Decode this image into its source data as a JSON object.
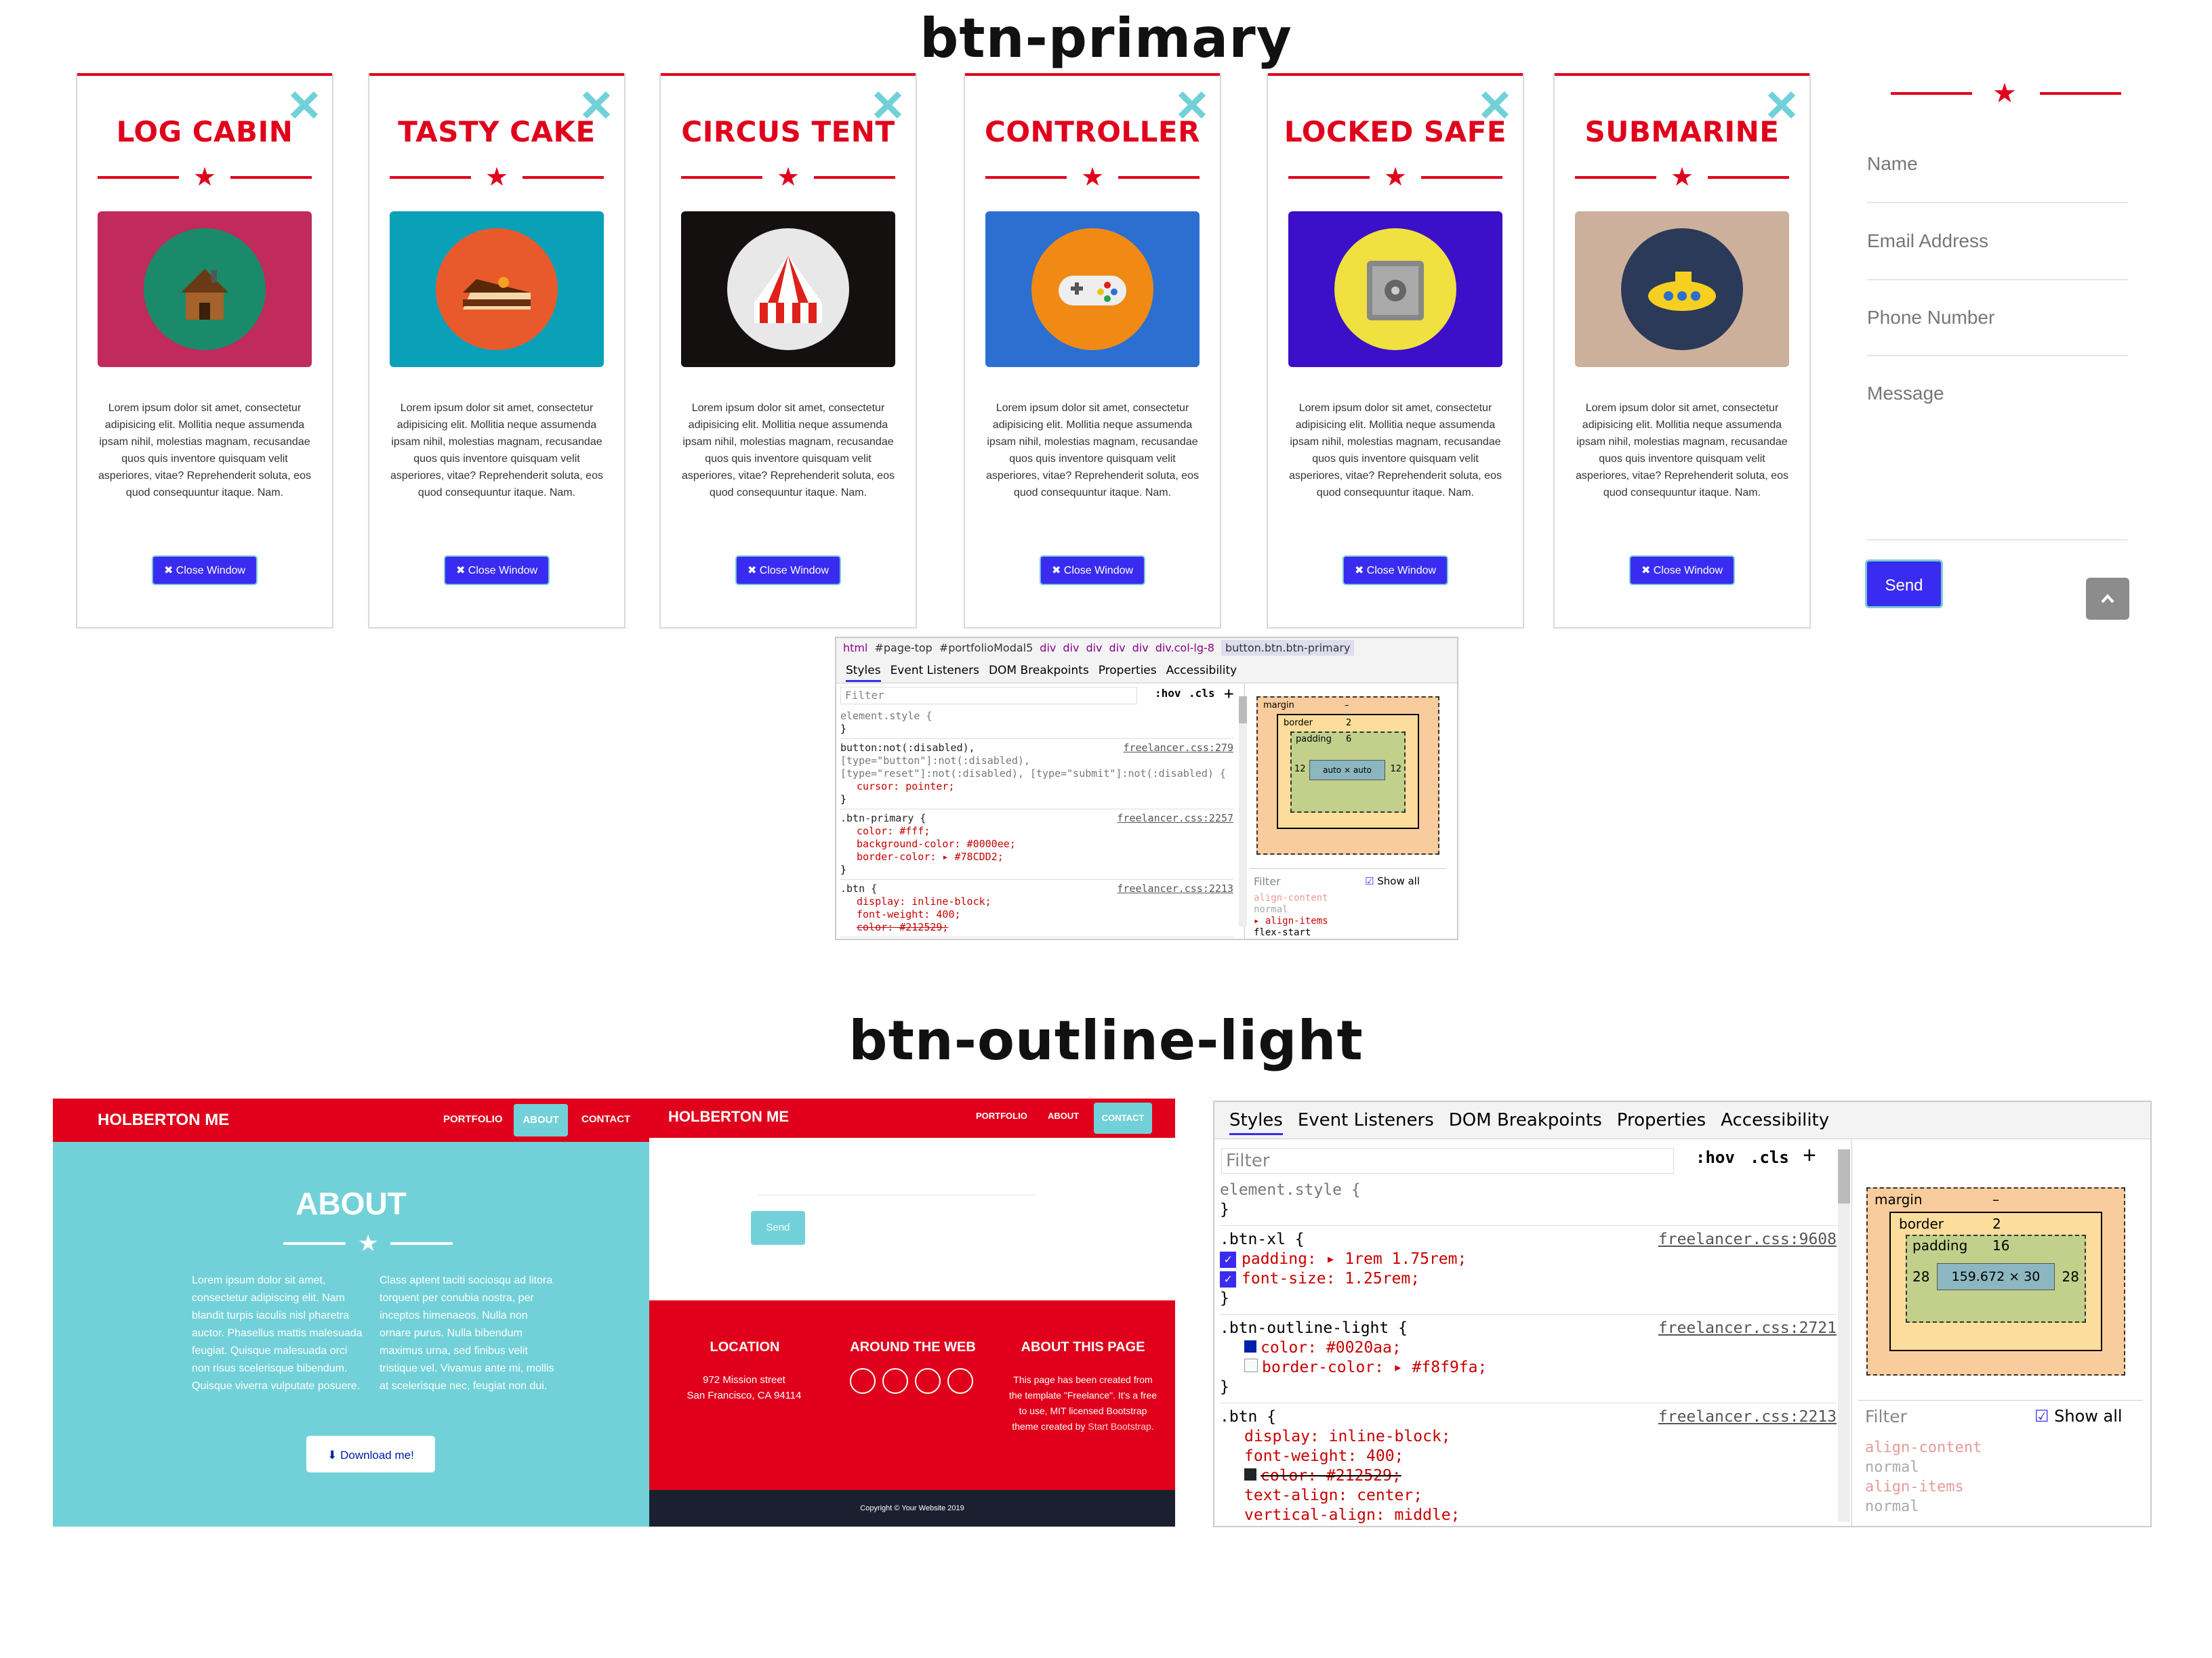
{
  "headings": {
    "primary": "btn-primary",
    "outline": "btn-outline-light"
  },
  "cards": [
    {
      "title": "LOG CABIN",
      "bg": "#c02a5c",
      "disc": "#1a8a6a",
      "icon": "cabin"
    },
    {
      "title": "TASTY CAKE",
      "bg": "#0aa0b8",
      "disc": "#e85a2c",
      "icon": "cake"
    },
    {
      "title": "CIRCUS TENT",
      "bg": "#141010",
      "disc": "#e8e8e8",
      "icon": "tent"
    },
    {
      "title": "CONTROLLER",
      "bg": "#2c6fd0",
      "disc": "#f08a14",
      "icon": "gamepad"
    },
    {
      "title": "LOCKED SAFE",
      "bg": "#3b10c8",
      "disc": "#f0e040",
      "icon": "safe"
    },
    {
      "title": "SUBMARINE",
      "bg": "#cdb09c",
      "disc": "#2a3a58",
      "icon": "submarine"
    }
  ],
  "card_text": "Lorem ipsum dolor sit amet, consectetur adipisicing elit. Mollitia neque assumenda ipsam nihil, molestias magnam, recusandae quos quis inventore quisquam velit asperiores, vitae? Reprehenderit soluta, eos quod consequuntur itaque. Nam.",
  "close_btn": "✖ Close Window",
  "form": {
    "name": "Name",
    "email": "Email Address",
    "phone": "Phone Number",
    "message": "Message",
    "send": "Send"
  },
  "devtools_small": {
    "breadcrumb": [
      "html",
      "#page-top",
      "#portfolioModal5",
      "div",
      "div",
      "div",
      "div",
      "div",
      "div.col-lg-8",
      "button.btn.btn-primary"
    ],
    "tabs": [
      "Styles",
      "Event Listeners",
      "DOM Breakpoints",
      "Properties",
      "Accessibility"
    ],
    "filter": "Filter",
    "hov": ":hov",
    "cls": ".cls",
    "rules": [
      {
        "sel": "element.style {",
        "src": "",
        "lines": [],
        "close": "}"
      },
      {
        "sel": "button:not(:disabled),",
        "sel2": "[type=\"button\"]:not(:disabled),",
        "sel3": "[type=\"reset\"]:not(:disabled), [type=\"submit\"]:not(:disabled) {",
        "src": "freelancer.css:279",
        "lines": [
          "cursor: pointer;"
        ],
        "close": "}"
      },
      {
        "sel": ".btn-primary {",
        "src": "freelancer.css:2257",
        "lines": [
          "color: #fff;",
          "background-color: #0000ee;",
          "border-color: ▸ #78CDD2;"
        ],
        "close": "}"
      },
      {
        "sel": ".btn {",
        "src": "freelancer.css:2213",
        "lines": [
          "display: inline-block;",
          "font-weight: 400;",
          "color: #212529;"
        ],
        "close": ""
      }
    ],
    "box": {
      "margin": "margin",
      "dash": "–",
      "border": "border",
      "border_v": "2",
      "padding": "padding",
      "padding_v": "6",
      "content": "auto × auto",
      "side_pad": "12",
      "side_border": "2"
    },
    "filter2": "Filter",
    "showall": "Show all",
    "computed": [
      "align-content",
      "normal",
      "▸ align-items",
      "flex-start"
    ]
  },
  "left_site": {
    "brand": "HOLBERTON ME",
    "nav": [
      "PORTFOLIO",
      "ABOUT",
      "CONTACT"
    ],
    "about_title": "ABOUT",
    "col1": "Lorem ipsum dolor sit amet, consectetur adipiscing elit. Nam blandit turpis iaculis nisl pharetra auctor. Phasellus mattis malesuada feugiat. Quisque malesuada orci non risus scelerisque bibendum. Quisque viverra vulputate posuere.",
    "col2": "Class aptent taciti sociosqu ad litora torquent per conubia nostra, per inceptos himenaeos. Nulla non ornare purus. Nulla bibendum maximus urna, sed finibus velit tristique vel. Vivamus ante mi, mollis at scelerisque nec, feugiat non dui.",
    "download": "Download me!"
  },
  "right_site": {
    "brand": "HOLBERTON ME",
    "nav": [
      "PORTFOLIO",
      "ABOUT",
      "CONTACT"
    ],
    "send": "Send",
    "location_title": "LOCATION",
    "location_1": "972 Mission street",
    "location_2": "San Francisco, CA 94114",
    "web_title": "AROUND THE WEB",
    "about_title": "ABOUT THIS PAGE",
    "about_text": "This page has been created from the template \"Freelance\". It's a free to use, MIT licensed Bootstrap theme created by",
    "about_link": "Start Bootstrap",
    "copyright": "Copyright © Your Website 2019"
  },
  "devtools_big": {
    "tabs": [
      "Styles",
      "Event Listeners",
      "DOM Breakpoints",
      "Properties",
      "Accessibility"
    ],
    "filter": "Filter",
    "hov": ":hov",
    "cls": ".cls",
    "rule0": "element.style {",
    "r1_sel": ".btn-xl {",
    "r1_src": "freelancer.css:9608",
    "r1_l1": "padding: ▸ 1rem 1.75rem;",
    "r1_l2": "font-size: 1.25rem;",
    "r2_sel": ".btn-outline-light {",
    "r2_src": "freelancer.css:2721",
    "r2_l1": "color: #0020aa;",
    "r2_l2": "border-color: ▸ #f8f9fa;",
    "r3_sel": ".btn {",
    "r3_src": "freelancer.css:2213",
    "r3_l1": "display: inline-block;",
    "r3_l2": "font-weight: 400;",
    "r3_l3": "color: #212529;",
    "r3_l4": "text-align: center;",
    "r3_l5": "vertical-align: middle;",
    "brace": "}",
    "box": {
      "margin": "margin",
      "dash": "–",
      "border": "border",
      "border_v": "2",
      "padding": "padding",
      "padding_v": "16",
      "content": "159.672 × 30",
      "side_pad": "28",
      "side_border": "2"
    },
    "filter2": "Filter",
    "showall": "Show all",
    "computed": [
      "align-content",
      "normal",
      "align-items",
      "normal"
    ]
  },
  "colors": {
    "red": "#e0001b",
    "teal": "#72d1d8",
    "blue": "#3a2bf0",
    "dark": "#1a2030"
  }
}
